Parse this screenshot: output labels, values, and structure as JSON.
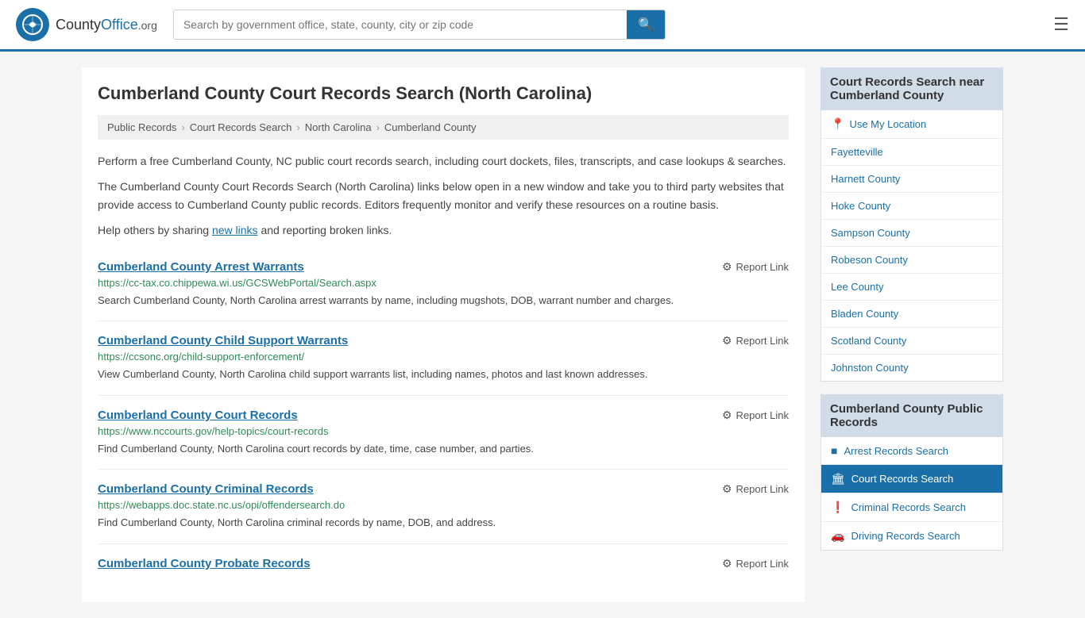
{
  "header": {
    "logo_text": "CountyOffice",
    "logo_suffix": ".org",
    "search_placeholder": "Search by government office, state, county, city or zip code",
    "search_button_icon": "🔍"
  },
  "page": {
    "title": "Cumberland County Court Records Search (North Carolina)"
  },
  "breadcrumb": {
    "items": [
      {
        "label": "Public Records",
        "href": "#"
      },
      {
        "label": "Court Records Search",
        "href": "#"
      },
      {
        "label": "North Carolina",
        "href": "#"
      },
      {
        "label": "Cumberland County",
        "href": "#"
      }
    ]
  },
  "intro": {
    "paragraph1": "Perform a free Cumberland County, NC public court records search, including court dockets, files, transcripts, and case lookups & searches.",
    "paragraph2": "The Cumberland County Court Records Search (North Carolina) links below open in a new window and take you to third party websites that provide access to Cumberland County public records. Editors frequently monitor and verify these resources on a routine basis.",
    "paragraph3_prefix": "Help others by sharing ",
    "paragraph3_link": "new links",
    "paragraph3_suffix": " and reporting broken links."
  },
  "records": [
    {
      "title": "Cumberland County Arrest Warrants",
      "url": "https://cc-tax.co.chippewa.wi.us/GCSWebPortal/Search.aspx",
      "description": "Search Cumberland County, North Carolina arrest warrants by name, including mugshots, DOB, warrant number and charges.",
      "report_label": "Report Link"
    },
    {
      "title": "Cumberland County Child Support Warrants",
      "url": "https://ccsonc.org/child-support-enforcement/",
      "description": "View Cumberland County, North Carolina child support warrants list, including names, photos and last known addresses.",
      "report_label": "Report Link"
    },
    {
      "title": "Cumberland County Court Records",
      "url": "https://www.nccourts.gov/help-topics/court-records",
      "description": "Find Cumberland County, North Carolina court records by date, time, case number, and parties.",
      "report_label": "Report Link"
    },
    {
      "title": "Cumberland County Criminal Records",
      "url": "https://webapps.doc.state.nc.us/opi/offendersearch.do",
      "description": "Find Cumberland County, North Carolina criminal records by name, DOB, and address.",
      "report_label": "Report Link"
    },
    {
      "title": "Cumberland County Probate Records",
      "url": "",
      "description": "",
      "report_label": "Report Link"
    }
  ],
  "sidebar": {
    "nearby_heading": "Court Records Search near Cumberland County",
    "nearby_items": [
      {
        "label": "Use My Location",
        "icon": "pin"
      },
      {
        "label": "Fayetteville"
      },
      {
        "label": "Harnett County"
      },
      {
        "label": "Hoke County"
      },
      {
        "label": "Sampson County"
      },
      {
        "label": "Robeson County"
      },
      {
        "label": "Lee County"
      },
      {
        "label": "Bladen County"
      },
      {
        "label": "Scotland County"
      },
      {
        "label": "Johnston County"
      }
    ],
    "public_records_heading": "Cumberland County Public Records",
    "public_records_items": [
      {
        "label": "Arrest Records Search",
        "icon": "■",
        "active": false
      },
      {
        "label": "Court Records Search",
        "icon": "🏛",
        "active": true
      },
      {
        "label": "Criminal Records Search",
        "icon": "!",
        "active": false
      },
      {
        "label": "Driving Records Search",
        "icon": "🚗",
        "active": false
      }
    ]
  }
}
